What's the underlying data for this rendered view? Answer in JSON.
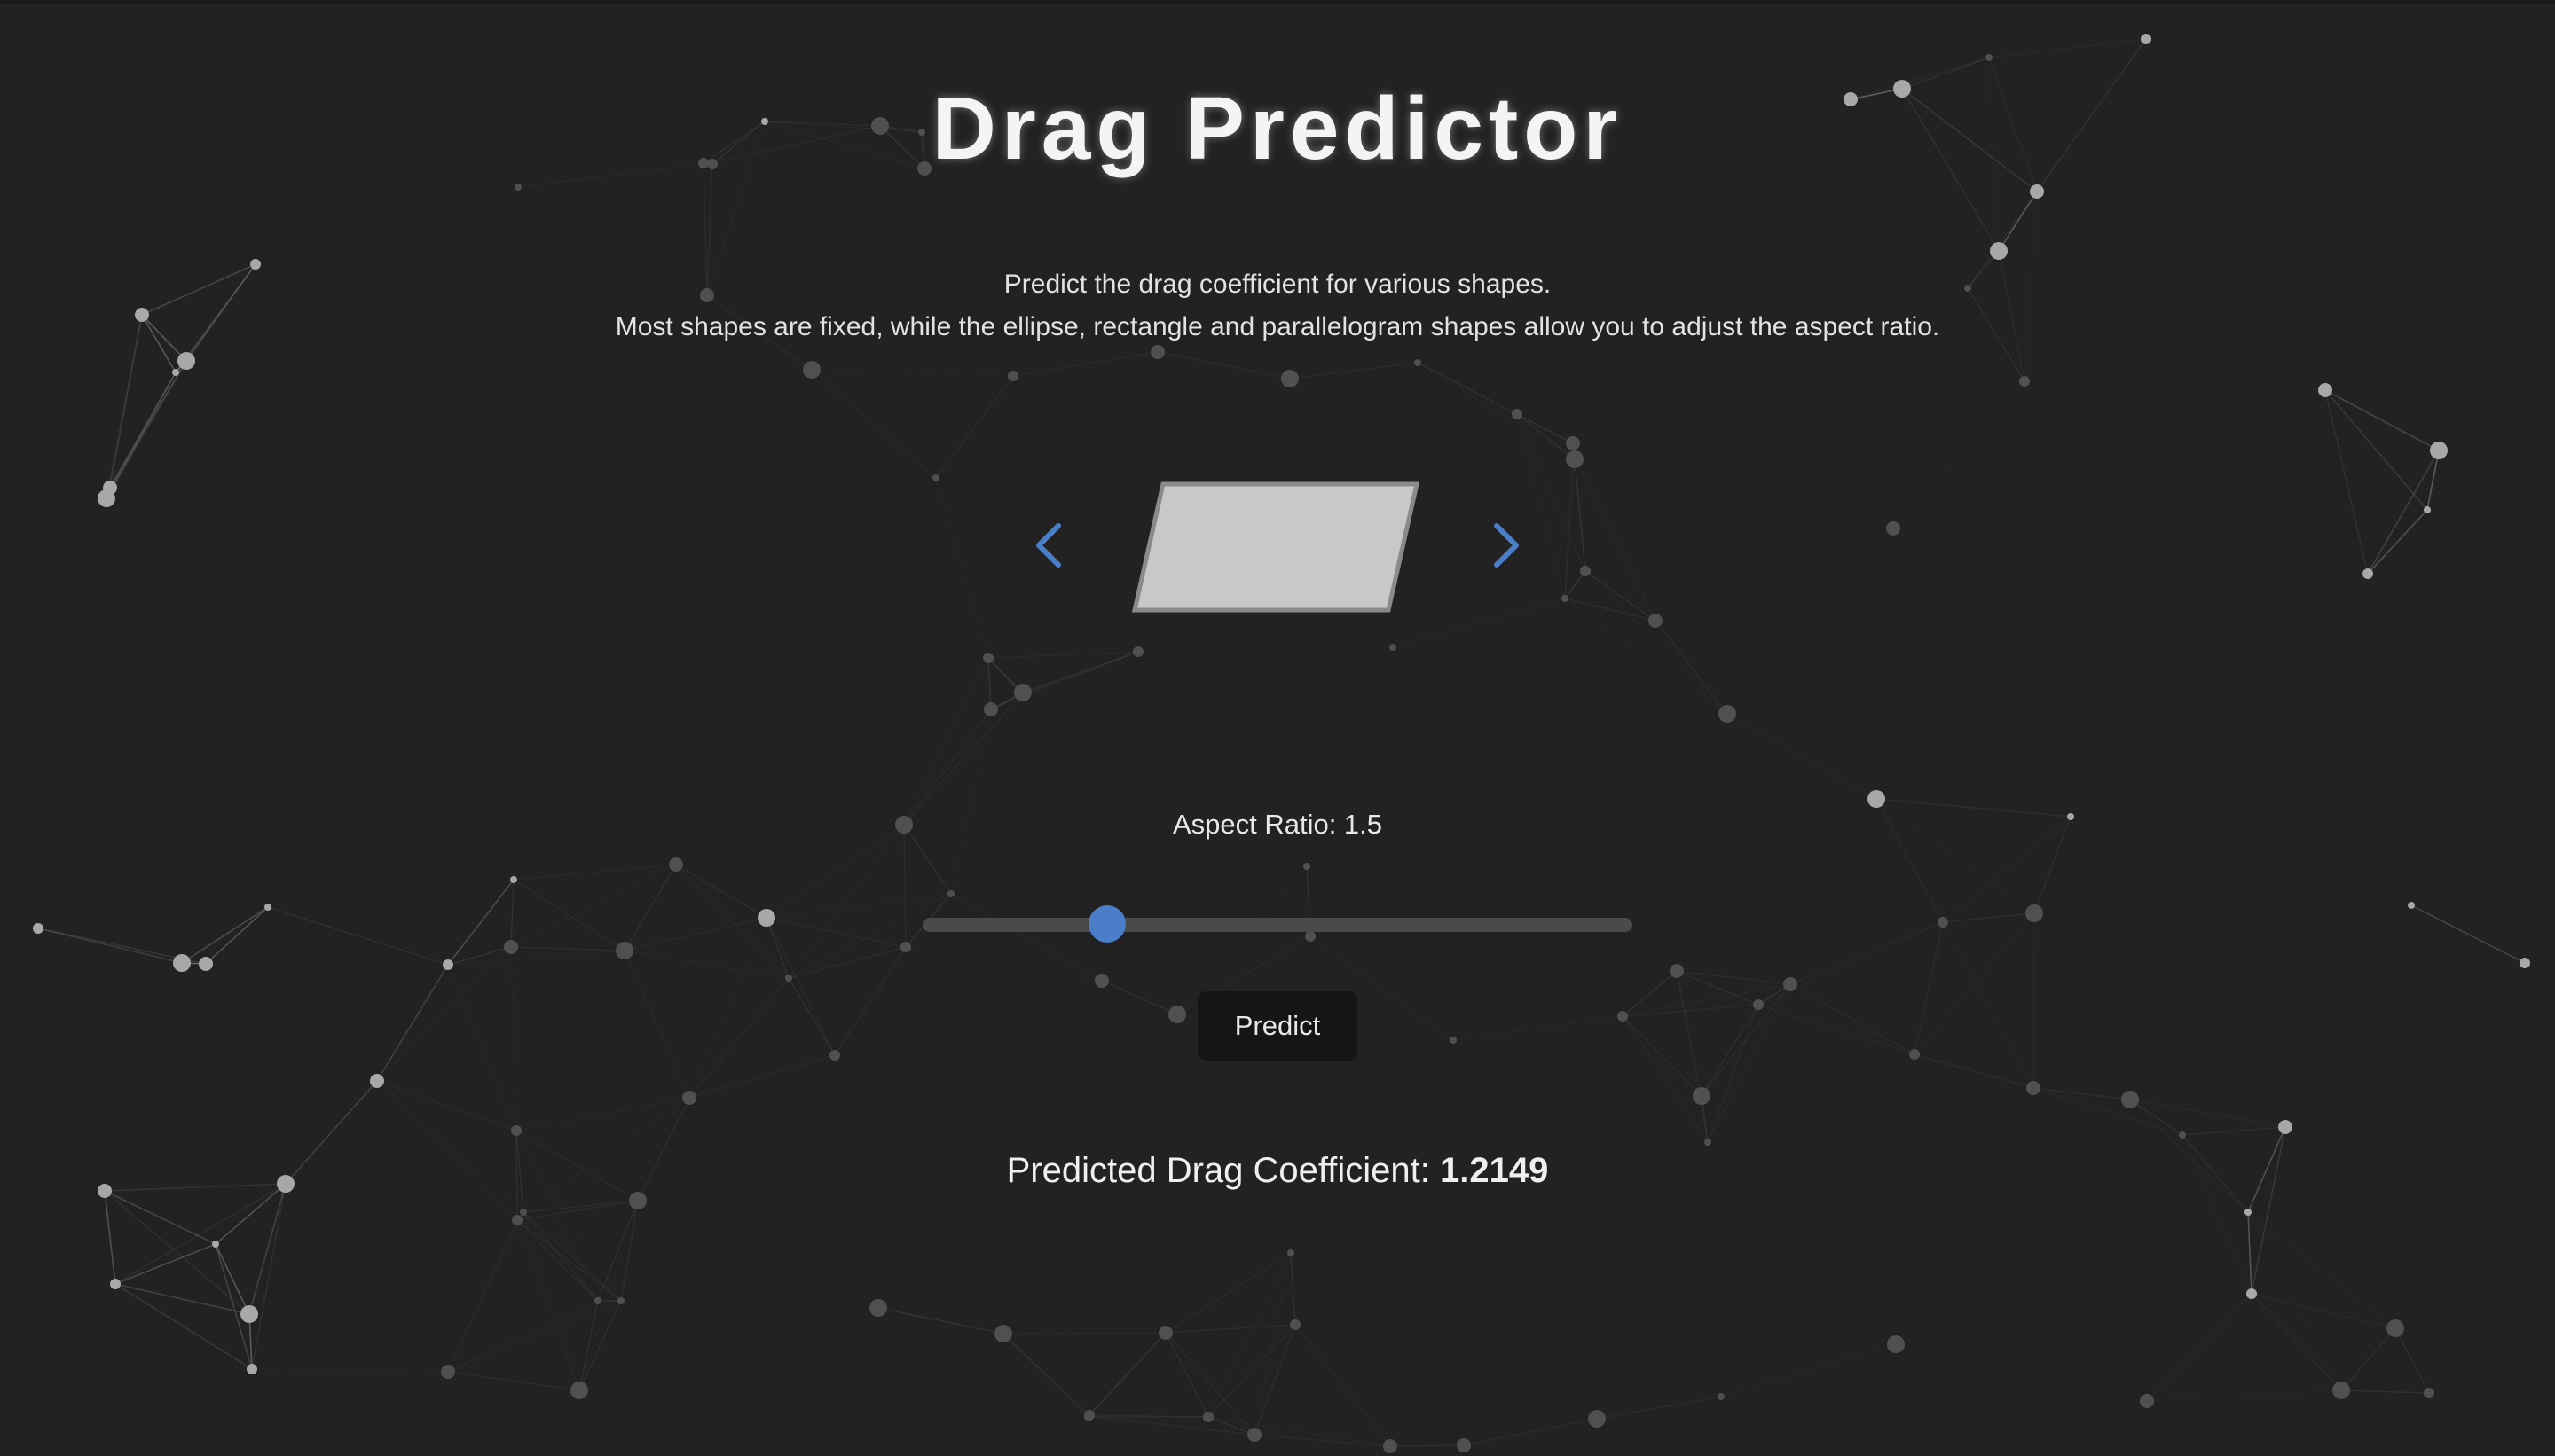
{
  "app": {
    "title": "Drag Predictor",
    "description_line1": "Predict the drag coefficient for various shapes.",
    "description_line2": "Most shapes are fixed, while the ellipse, rectangle and parallelogram shapes allow you to adjust the aspect ratio."
  },
  "shape_selector": {
    "current_shape": "parallelogram",
    "prev_icon": "chevron-left-icon",
    "next_icon": "chevron-right-icon",
    "shape_fill": "#c8c8c8",
    "shape_stroke": "#8a8a8a",
    "arrow_color": "#4a7ec9"
  },
  "aspect_ratio": {
    "label": "Aspect Ratio: 1.5",
    "value": 1.5,
    "slider_fraction": 0.26
  },
  "predict_button": {
    "label": "Predict"
  },
  "result": {
    "label": "Predicted Drag Coefficient:",
    "value": "1.2149"
  },
  "colors": {
    "background": "#222222",
    "accent": "#4a7ec9",
    "text": "#e6e6e6"
  }
}
